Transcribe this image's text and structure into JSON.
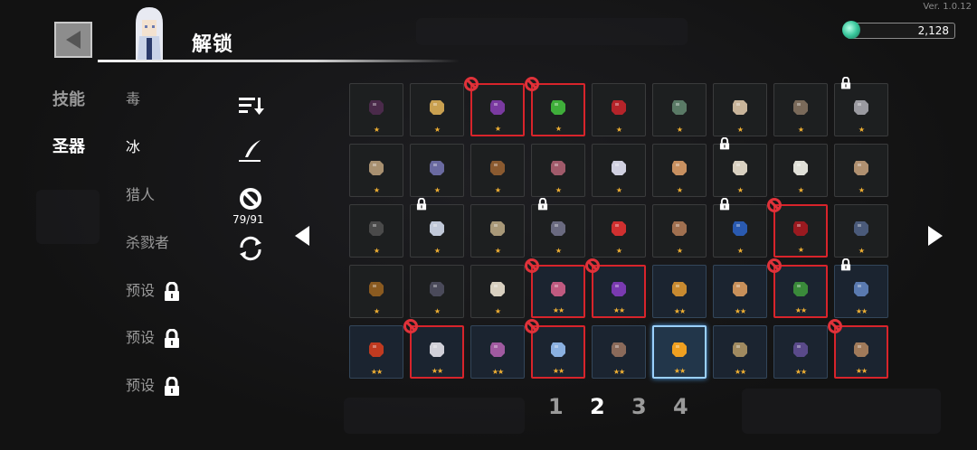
{
  "header": {
    "title": "解锁",
    "version": "Ver. 1.0.12",
    "currency": "2,128"
  },
  "tabs": [
    {
      "label": "技能",
      "active": false
    },
    {
      "label": "圣器",
      "active": true
    }
  ],
  "filters": [
    {
      "label": "毒",
      "active": false,
      "locked": false
    },
    {
      "label": "冰",
      "active": true,
      "locked": false
    },
    {
      "label": "猎人",
      "active": false,
      "locked": false
    },
    {
      "label": "杀戮者",
      "active": false,
      "locked": false
    },
    {
      "label": "预设",
      "active": false,
      "locked": true
    },
    {
      "label": "预设",
      "active": false,
      "locked": true
    },
    {
      "label": "预设",
      "active": false,
      "locked": true
    }
  ],
  "tools": {
    "sort_icon": "sort-icon",
    "edit_icon": "quill-icon",
    "ban_icon": "ban-icon",
    "reset_icon": "refresh-icon",
    "ban_count": "79/91"
  },
  "pages": [
    {
      "label": "1",
      "active": false
    },
    {
      "label": "2",
      "active": true
    },
    {
      "label": "3",
      "active": false
    },
    {
      "label": "4",
      "active": false
    }
  ],
  "colors": {
    "banned": "#d8242b",
    "star": "#f0b033",
    "selected": "#9ad0ff"
  },
  "grid": [
    [
      {
        "icon": "bat-wings",
        "stars": "★",
        "tier": 1,
        "banned": false,
        "locked": false,
        "color": "#4a2a4a"
      },
      {
        "icon": "bread",
        "stars": "★",
        "tier": 1,
        "banned": false,
        "locked": false,
        "color": "#c9a050"
      },
      {
        "icon": "poison-flask",
        "stars": "★",
        "tier": 1,
        "banned": true,
        "locked": false,
        "color": "#7a3aa0"
      },
      {
        "icon": "green-spores",
        "stars": "★",
        "tier": 1,
        "banned": true,
        "locked": false,
        "color": "#3fae3a"
      },
      {
        "icon": "red-berry",
        "stars": "★",
        "tier": 1,
        "banned": false,
        "locked": false,
        "color": "#b5242a"
      },
      {
        "icon": "green-jar",
        "stars": "★",
        "tier": 1,
        "banned": false,
        "locked": false,
        "color": "#5a7a66"
      },
      {
        "icon": "fang",
        "stars": "★",
        "tier": 1,
        "banned": false,
        "locked": false,
        "color": "#c8b49a"
      },
      {
        "icon": "necklace",
        "stars": "★",
        "tier": 1,
        "banned": false,
        "locked": false,
        "color": "#7a6a5a"
      },
      {
        "icon": "stone",
        "stars": "★",
        "tier": 1,
        "banned": false,
        "locked": true,
        "color": "#9a9aa0"
      }
    ],
    [
      {
        "icon": "rock",
        "stars": "★",
        "tier": 1,
        "banned": false,
        "locked": false,
        "color": "#a89070"
      },
      {
        "icon": "feather-blue",
        "stars": "★",
        "tier": 1,
        "banned": false,
        "locked": false,
        "color": "#6a6aa0"
      },
      {
        "icon": "chest",
        "stars": "★",
        "tier": 1,
        "banned": false,
        "locked": false,
        "color": "#8a5a30"
      },
      {
        "icon": "meat",
        "stars": "★",
        "tier": 1,
        "banned": false,
        "locked": false,
        "color": "#a05a6a"
      },
      {
        "icon": "claw-marks",
        "stars": "★",
        "tier": 1,
        "banned": false,
        "locked": false,
        "color": "#d0d0e0"
      },
      {
        "icon": "ginger-root",
        "stars": "★",
        "tier": 1,
        "banned": false,
        "locked": false,
        "color": "#c89060"
      },
      {
        "icon": "quill",
        "stars": "★",
        "tier": 1,
        "banned": false,
        "locked": true,
        "color": "#d8d0c0"
      },
      {
        "icon": "feather-duster",
        "stars": "★",
        "tier": 1,
        "banned": false,
        "locked": false,
        "color": "#e0e0d8"
      },
      {
        "icon": "bandage-arm",
        "stars": "★",
        "tier": 1,
        "banned": false,
        "locked": false,
        "color": "#b09070"
      }
    ],
    [
      {
        "icon": "frying-pan",
        "stars": "★",
        "tier": 1,
        "banned": false,
        "locked": false,
        "color": "#4a4a4a"
      },
      {
        "icon": "headband",
        "stars": "★",
        "tier": 1,
        "banned": false,
        "locked": true,
        "color": "#c0c8d8"
      },
      {
        "icon": "scroll",
        "stars": "★",
        "tier": 1,
        "banned": false,
        "locked": false,
        "color": "#a89878"
      },
      {
        "icon": "armor",
        "stars": "★",
        "tier": 1,
        "banned": false,
        "locked": true,
        "color": "#6a6a80"
      },
      {
        "icon": "magnet",
        "stars": "★",
        "tier": 1,
        "banned": false,
        "locked": false,
        "color": "#d03030"
      },
      {
        "icon": "arrow",
        "stars": "★",
        "tier": 1,
        "banned": false,
        "locked": false,
        "color": "#a07050"
      },
      {
        "icon": "blue-shield",
        "stars": "★",
        "tier": 1,
        "banned": false,
        "locked": true,
        "color": "#2a5ab0"
      },
      {
        "icon": "red-cloth",
        "stars": "★",
        "tier": 1,
        "banned": true,
        "locked": false,
        "color": "#9a1a20"
      },
      {
        "icon": "snake",
        "stars": "★",
        "tier": 1,
        "banned": false,
        "locked": false,
        "color": "#4a5a7a"
      }
    ],
    [
      {
        "icon": "small-ember",
        "stars": "★",
        "tier": 1,
        "banned": false,
        "locked": false,
        "color": "#8a5a20"
      },
      {
        "icon": "dark-beetle",
        "stars": "★",
        "tier": 1,
        "banned": false,
        "locked": false,
        "color": "#4a4a5a"
      },
      {
        "icon": "bone",
        "stars": "★",
        "tier": 1,
        "banned": false,
        "locked": false,
        "color": "#d8d0c0"
      },
      {
        "icon": "ice-crown",
        "stars": "★★",
        "tier": 2,
        "banned": true,
        "locked": false,
        "color": "#c05a80"
      },
      {
        "icon": "eggplant",
        "stars": "★★",
        "tier": 2,
        "banned": true,
        "locked": false,
        "color": "#7a3ab0"
      },
      {
        "icon": "potion-bottle",
        "stars": "★★",
        "tier": 2,
        "banned": false,
        "locked": false,
        "color": "#c88a30"
      },
      {
        "icon": "shell",
        "stars": "★★",
        "tier": 2,
        "banned": false,
        "locked": false,
        "color": "#c8905a"
      },
      {
        "icon": "green-tag",
        "stars": "★★",
        "tier": 2,
        "banned": true,
        "locked": false,
        "color": "#3a8a3a"
      },
      {
        "icon": "blue-robot",
        "stars": "★★",
        "tier": 2,
        "banned": false,
        "locked": true,
        "color": "#5a7ab0"
      }
    ],
    [
      {
        "icon": "red-eye",
        "stars": "★★",
        "tier": 2,
        "banned": false,
        "locked": false,
        "color": "#c03a20"
      },
      {
        "icon": "dice",
        "stars": "★★",
        "tier": 2,
        "banned": true,
        "locked": false,
        "color": "#d0d0d8"
      },
      {
        "icon": "purple-book",
        "stars": "★★",
        "tier": 2,
        "banned": false,
        "locked": false,
        "color": "#a05aa0"
      },
      {
        "icon": "ice-shard",
        "stars": "★★",
        "tier": 2,
        "banned": true,
        "locked": false,
        "color": "#8ab0e0"
      },
      {
        "icon": "bat-cloak",
        "stars": "★★",
        "tier": 2,
        "banned": false,
        "locked": false,
        "color": "#8a6a5a"
      },
      {
        "icon": "orange-slice",
        "stars": "★★",
        "tier": 2,
        "banned": false,
        "locked": false,
        "selected": true,
        "color": "#f0a020"
      },
      {
        "icon": "dagger",
        "stars": "★★",
        "tier": 2,
        "banned": false,
        "locked": false,
        "color": "#a08a60"
      },
      {
        "icon": "dark-feather",
        "stars": "★★",
        "tier": 2,
        "banned": false,
        "locked": false,
        "color": "#5a4a8a"
      },
      {
        "icon": "wooden-doll",
        "stars": "★★",
        "tier": 2,
        "banned": true,
        "locked": false,
        "color": "#a07a5a"
      }
    ]
  ]
}
